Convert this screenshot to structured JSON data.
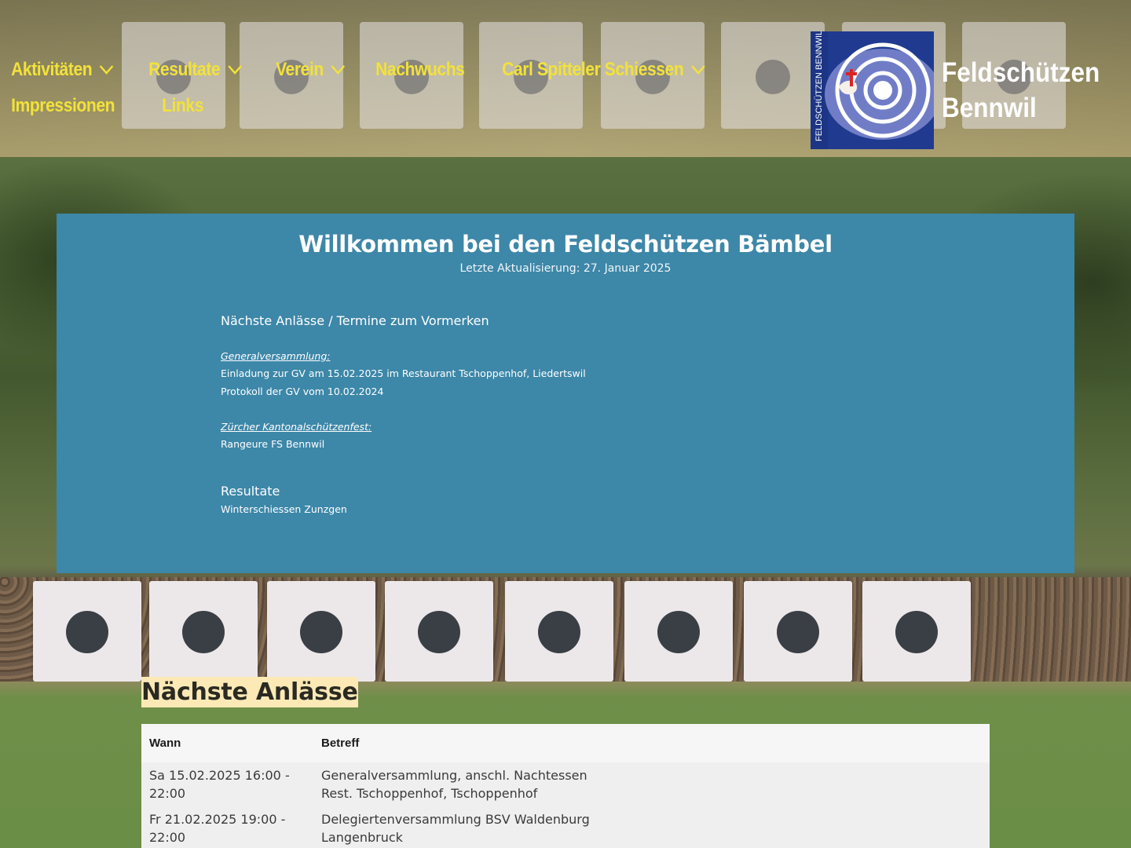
{
  "header": {
    "nav": [
      {
        "label": "Aktivitäten",
        "has_dropdown": true
      },
      {
        "label": "Resultate",
        "has_dropdown": true
      },
      {
        "label": "Verein",
        "has_dropdown": true
      },
      {
        "label": "Nachwuchs",
        "has_dropdown": false
      },
      {
        "label": "Carl Spitteler Schiessen",
        "has_dropdown": true
      },
      {
        "label": "Impressionen",
        "has_dropdown": false
      },
      {
        "label": "Links",
        "has_dropdown": false
      }
    ],
    "brand": {
      "line1": "Feldschützen",
      "line2": "Bennwil",
      "logo_text": "FELDSCHÜTZEN BENNWIL"
    },
    "nav_color": "#f2e23a"
  },
  "welcome": {
    "title": "Willkommen bei den Feldschützen Bämbel",
    "updated": "Letzte Aktualisierung:  27. Januar 2025",
    "section_heading": "Nächste Anlässe / Termine zum Vormerken",
    "gv": {
      "heading": "Generalversammlung:",
      "items": [
        "Einladung zur GV am 15.02.2025 im Restaurant Tschoppenhof, Liedertswil",
        "Protokoll der GV vom 10.02.2024"
      ]
    },
    "zkf": {
      "heading": "Zürcher Kantonalschützenfest:",
      "items": [
        "Rangeure FS Bennwil"
      ]
    },
    "results": {
      "heading": "Resultate",
      "items": [
        "Winterschiessen Zunzgen"
      ]
    },
    "panel_color": "#3d87a8"
  },
  "events": {
    "title": "Nächste Anlässe",
    "columns": [
      "Wann",
      "Betreff"
    ],
    "rows": [
      {
        "when": "Sa 15.02.2025 16:00 - 22:00",
        "subject_line1": "Generalversammlung, anschl. Nachtessen",
        "subject_line2": "Rest. Tschoppenhof, Tschoppenhof"
      },
      {
        "when": "Fr 21.02.2025 19:00 - 22:00",
        "subject_line1": "Delegiertenversammlung BSV Waldenburg",
        "subject_line2": "Langenbruck"
      }
    ]
  }
}
